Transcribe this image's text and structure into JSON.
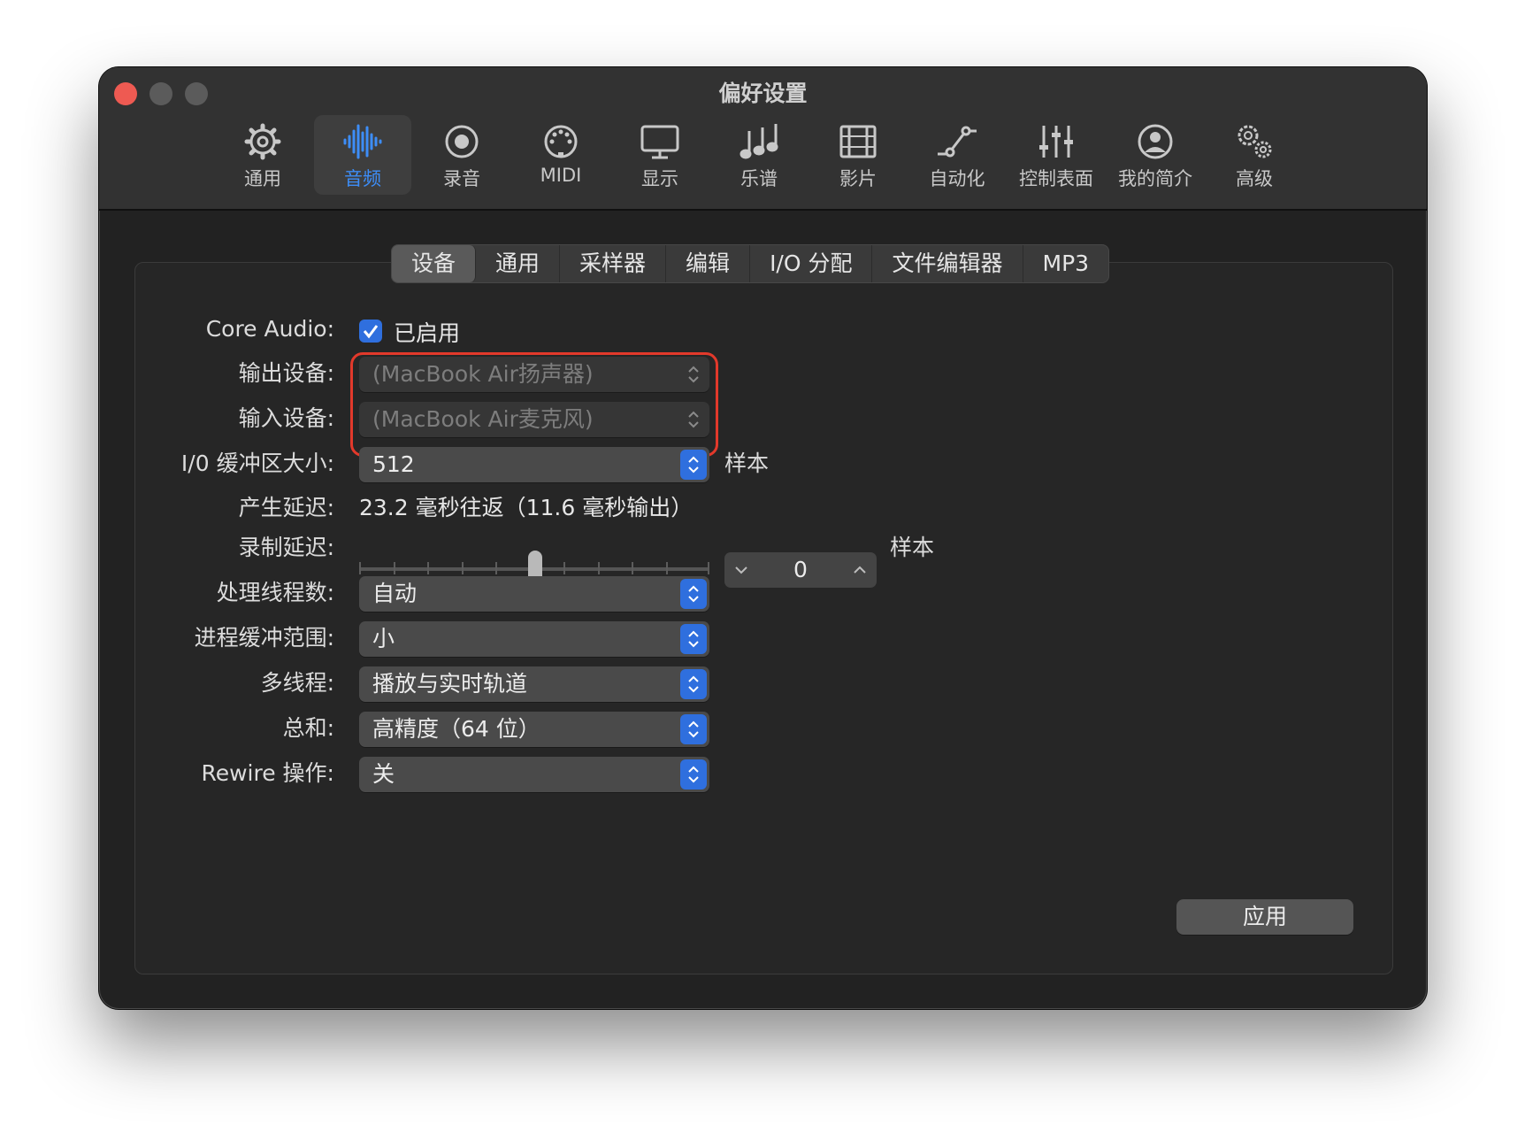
{
  "window": {
    "title": "偏好设置"
  },
  "toolbar": {
    "items": [
      {
        "label": "通用",
        "icon": "gear-icon",
        "active": false
      },
      {
        "label": "音频",
        "icon": "waveform-icon",
        "active": true
      },
      {
        "label": "录音",
        "icon": "record-icon",
        "active": false
      },
      {
        "label": "MIDI",
        "icon": "midi-icon",
        "active": false
      },
      {
        "label": "显示",
        "icon": "display-icon",
        "active": false
      },
      {
        "label": "乐谱",
        "icon": "music-notes-icon",
        "active": false
      },
      {
        "label": "影片",
        "icon": "film-icon",
        "active": false
      },
      {
        "label": "自动化",
        "icon": "automation-icon",
        "active": false
      },
      {
        "label": "控制表面",
        "icon": "sliders-icon",
        "active": false
      },
      {
        "label": "我的简介",
        "icon": "profile-icon",
        "active": false
      },
      {
        "label": "高级",
        "icon": "advanced-gears-icon",
        "active": false
      }
    ]
  },
  "tabs": [
    "设备",
    "通用",
    "采样器",
    "编辑",
    "I/O 分配",
    "文件编辑器",
    "MP3"
  ],
  "form": {
    "core_audio": {
      "label": "Core Audio:",
      "checkbox_label": "已启用",
      "checked": true
    },
    "output_device": {
      "label": "输出设备:",
      "value": "(MacBook Air扬声器)"
    },
    "input_device": {
      "label": "输入设备:",
      "value": "(MacBook Air麦克风)"
    },
    "io_buffer": {
      "label": "I/0 缓冲区大小:",
      "value": "512",
      "unit": "样本"
    },
    "latency": {
      "label": "产生延迟:",
      "value": "23.2 毫秒往返（11.6 毫秒输出）"
    },
    "rec_delay": {
      "label": "录制延迟:",
      "value": "0",
      "unit": "样本"
    },
    "threads": {
      "label": "处理线程数:",
      "value": "自动"
    },
    "process_buffer": {
      "label": "进程缓冲范围:",
      "value": "小"
    },
    "multithreading": {
      "label": "多线程:",
      "value": "播放与实时轨道"
    },
    "summing": {
      "label": "总和:",
      "value": "高精度（64 位）"
    },
    "rewire": {
      "label": "Rewire 操作:",
      "value": "关"
    }
  },
  "apply_label": "应用",
  "colors": {
    "accent": "#2f6fde",
    "active_tab_icon": "#3d8df7",
    "highlight_outline": "#e2392b"
  }
}
